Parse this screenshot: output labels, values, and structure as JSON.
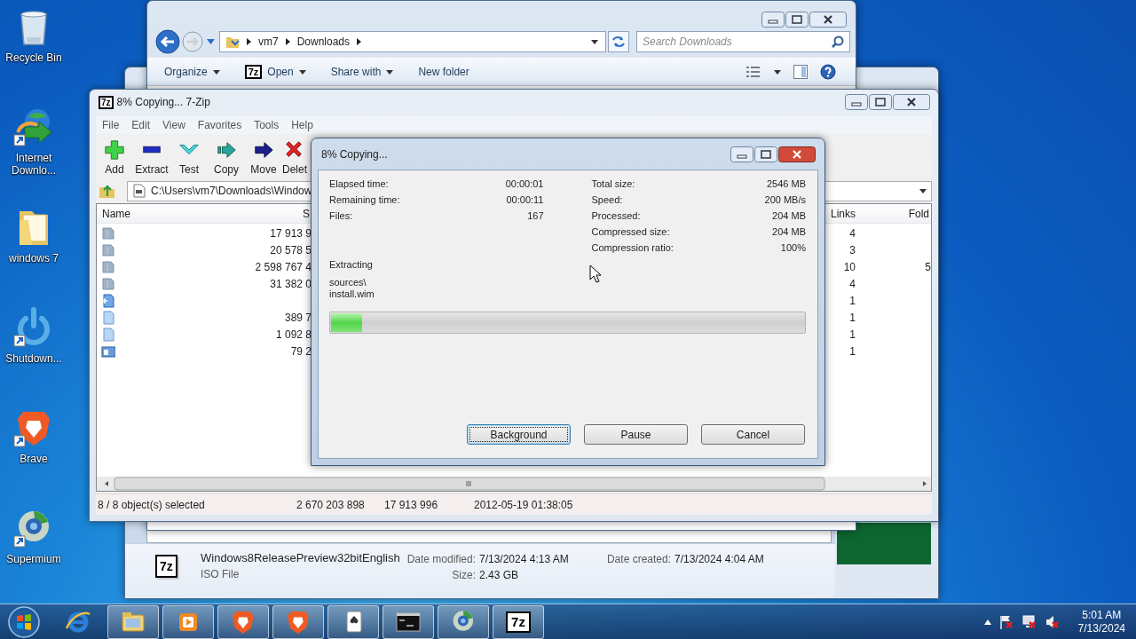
{
  "desktop": {
    "icons": [
      {
        "label": "Recycle Bin",
        "kind": "recycle",
        "shortcut": false
      },
      {
        "label": "Internet Downlo...",
        "kind": "download",
        "shortcut": true
      },
      {
        "label": "windows 7",
        "kind": "folder",
        "shortcut": false
      },
      {
        "label": "Shutdown...",
        "kind": "power",
        "shortcut": true
      },
      {
        "label": "Brave",
        "kind": "lion",
        "shortcut": true
      },
      {
        "label": "Supermium",
        "kind": "globe",
        "shortcut": true
      }
    ]
  },
  "explorer": {
    "breadcrumb": [
      "vm7",
      "Downloads"
    ],
    "search": {
      "placeholder": "Search Downloads"
    },
    "toolbar": [
      {
        "label": "Organize",
        "kind": "menu"
      },
      {
        "label": "Open",
        "kind": "app",
        "icon_text": "7z"
      },
      {
        "label": "Share with",
        "kind": "menu"
      },
      {
        "label": "New folder",
        "kind": "plain"
      }
    ]
  },
  "details_pane": {
    "icon_text": "7z",
    "name": "Windows8ReleasePreview32bitEnglish",
    "type": "ISO File",
    "fields": [
      {
        "label": "Date modified:",
        "value": "7/13/2024 4:13 AM"
      },
      {
        "label": "Size:",
        "value": "2.43 GB"
      },
      {
        "label": "Date created:",
        "value": "7/13/2024 4:04 AM"
      }
    ]
  },
  "archive_window": {
    "icon_text": "7z",
    "title": "8% Copying... 7-Zip",
    "menu": [
      "File",
      "Edit",
      "View",
      "Favorites",
      "Tools",
      "Help"
    ],
    "toolbar": [
      {
        "label": "Add",
        "kind": "add"
      },
      {
        "label": "Extract",
        "kind": "extract"
      },
      {
        "label": "Test",
        "kind": "test"
      },
      {
        "label": "Copy",
        "kind": "copy"
      },
      {
        "label": "Move",
        "kind": "move"
      },
      {
        "label": "Delet",
        "kind": "delete"
      }
    ],
    "path": "C:\\Users\\vm7\\Downloads\\Window",
    "columns": [
      "Name",
      "S",
      "Links",
      "Fold"
    ],
    "rows": [
      {
        "kind": "folder",
        "size": "17 913 9",
        "links": "4"
      },
      {
        "kind": "folder",
        "size": "20 578 5",
        "links": "3"
      },
      {
        "kind": "folder",
        "size": "2 598 767 4",
        "links": "10",
        "fold": "5"
      },
      {
        "kind": "folder",
        "size": "31 382 0",
        "links": "4"
      },
      {
        "kind": "setup",
        "links": "1"
      },
      {
        "kind": "file",
        "size": "389 7",
        "links": "1"
      },
      {
        "kind": "file",
        "size": "1 092 8",
        "links": "1"
      },
      {
        "kind": "app",
        "size": "79 2",
        "links": "1"
      }
    ],
    "status_bar": [
      "8 / 8 object(s) selected",
      "2 670 203 898",
      "17 913 996",
      "2012-05-19 01:38:05"
    ]
  },
  "dialog": {
    "title": "8% Copying...",
    "stats_left": [
      {
        "label": "Elapsed time:",
        "value": "00:00:01"
      },
      {
        "label": "Remaining time:",
        "value": "00:00:11"
      },
      {
        "label": "Files:",
        "value": "167"
      }
    ],
    "stats_right": [
      {
        "label": "Total size:",
        "value": "2546 MB"
      },
      {
        "label": "Speed:",
        "value": "200 MB/s"
      },
      {
        "label": "Processed:",
        "value": "204 MB"
      },
      {
        "label": "Compressed size:",
        "value": "204 MB"
      },
      {
        "label": "Compression ratio:",
        "value": "100%"
      }
    ],
    "operation": "Extracting",
    "current_file": [
      "sources\\",
      "install.wim"
    ],
    "progress": {
      "level": 0.065
    },
    "buttons": [
      {
        "label": "Background",
        "focused": true
      },
      {
        "label": "Pause",
        "focused": false
      },
      {
        "label": "Cancel",
        "focused": false
      }
    ]
  },
  "taskbar": {
    "buttons": [
      {
        "kind": "ie",
        "running": false
      },
      {
        "kind": "explorer",
        "running": true
      },
      {
        "kind": "media",
        "running": true
      },
      {
        "kind": "brave",
        "running": true
      },
      {
        "kind": "brave",
        "running": true
      },
      {
        "kind": "solitaire",
        "running": true
      },
      {
        "kind": "cmd",
        "running": true
      },
      {
        "kind": "globe",
        "running": true
      },
      {
        "kind": "sevenzip",
        "running": true,
        "icon_text": "7z"
      }
    ],
    "clock": {
      "time": "5:01 AM",
      "date": "7/13/2024"
    }
  }
}
